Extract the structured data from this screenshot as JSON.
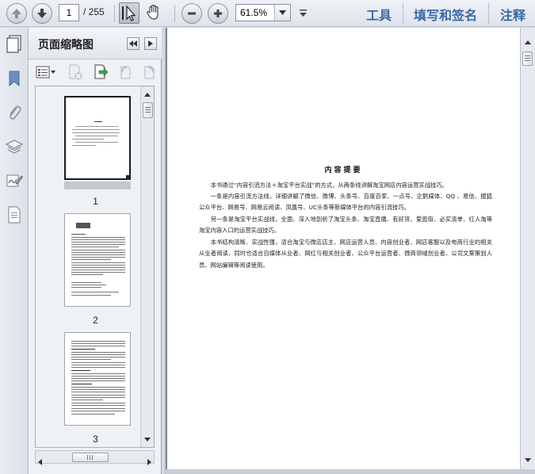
{
  "toolbar": {
    "page_current": "1",
    "page_total": "/ 255",
    "zoom": "61.5%",
    "tools_link": "工具",
    "fill_sign_link": "填写和签名",
    "comment_link": "注释"
  },
  "icons": {
    "prev_page": "arrow-up-icon",
    "next_page": "arrow-down-icon",
    "select": "cursor-icon",
    "hand": "hand-icon",
    "zoom_out": "minus-icon",
    "zoom_in": "plus-icon",
    "dropdown": "chevron-down-icon"
  },
  "thumbnail_panel": {
    "title": "页面缩略图",
    "pages": [
      {
        "label": "1"
      },
      {
        "label": "2"
      },
      {
        "label": "3"
      }
    ]
  },
  "document": {
    "title": "内容提要",
    "paragraphs": [
      "本书通过“内容引流方法＋淘宝平台实战”的方式，从两条线讲解淘宝网店内容运营实战技巧。",
      "一条是内容引流方法线，详细讲解了微信、微博、头条号、百度百家、一点号、企鹅媒体、QQ 、易信、搜狐公众平台、网易号、网易云阅读、凤凰号、UC头条等新媒体平台的内容引流技巧。",
      "另一条是淘宝平台实战线，全面、深入地剖析了淘宝头条、淘宝直播、有好货、爱逛街、必买清单、红人淘等淘宝内容入口的运营实战技巧。",
      "本书结构清晰、实战性强，适合淘宝与微店店主、网店运营人员、内容创业者、网店客服以及电商行业的相关从业者阅读，同时也适合自媒体从业者、网红与相关创业者、公众平台运营者、微商领域创业者、公司文案策划人员、网站编辑等阅读使用。"
    ]
  }
}
